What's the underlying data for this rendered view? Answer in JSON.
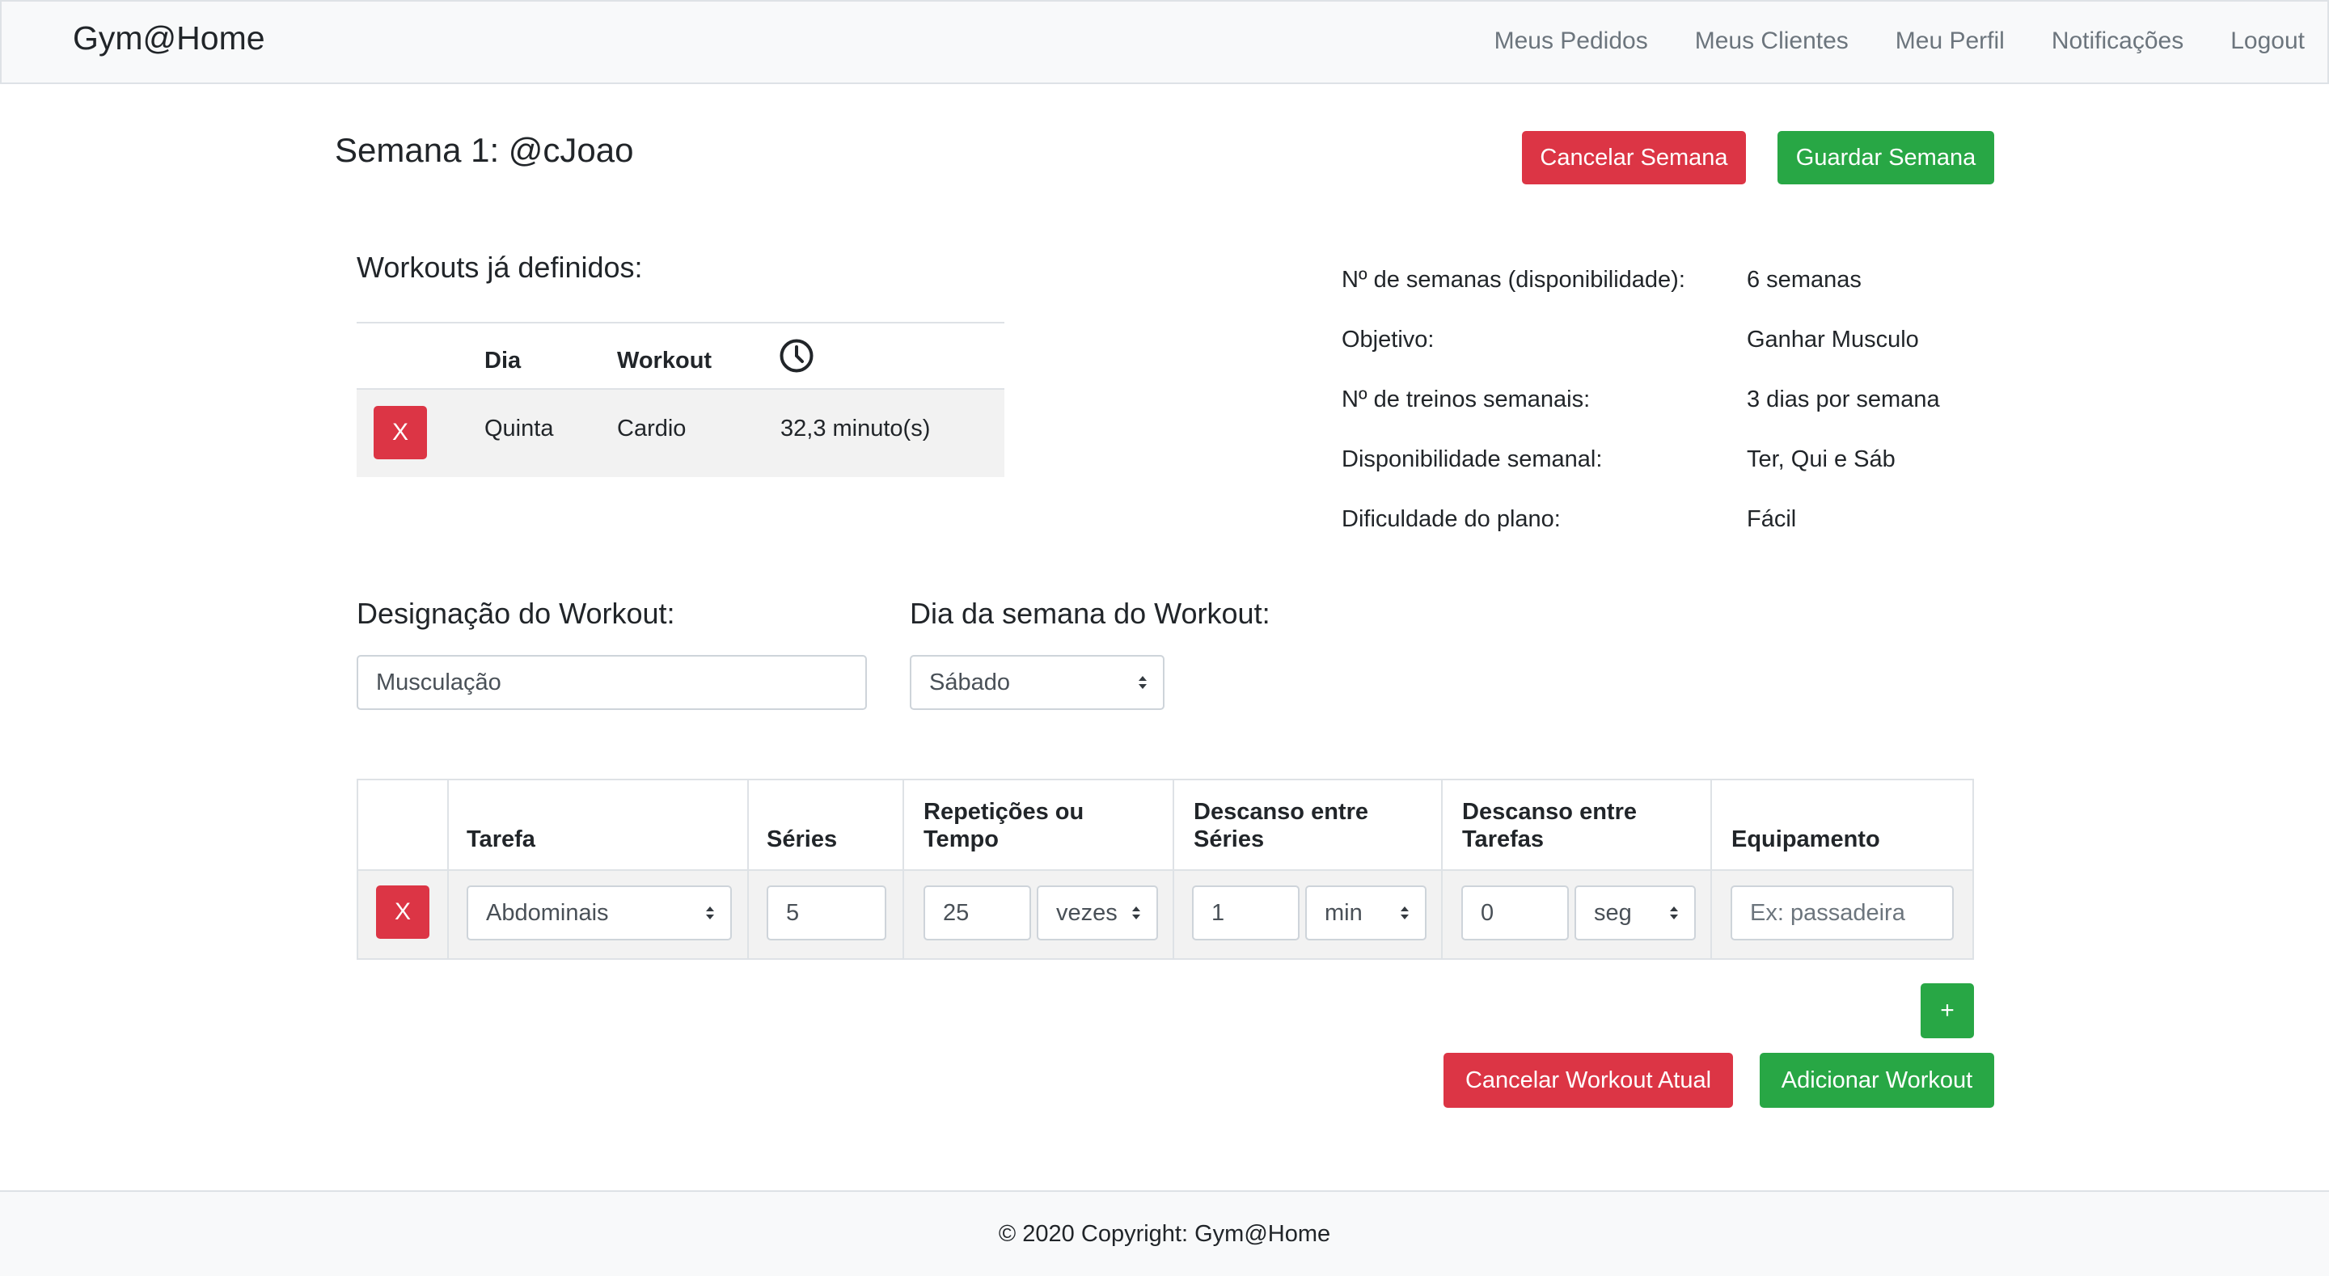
{
  "navbar": {
    "brand": "Gym@Home",
    "links": [
      "Meus Pedidos",
      "Meus Clientes",
      "Meu Perfil",
      "Notificações",
      "Logout"
    ]
  },
  "page": {
    "title": "Semana 1: @cJoao",
    "cancel_week": "Cancelar Semana",
    "save_week": "Guardar Semana"
  },
  "defined_workouts": {
    "title": "Workouts já definidos:",
    "headers": {
      "day": "Dia",
      "workout": "Workout",
      "duration_icon": "clock-icon"
    },
    "rows": [
      {
        "remove": "X",
        "day": "Quinta",
        "workout": "Cardio",
        "duration": "32,3 minuto(s)"
      }
    ]
  },
  "client_info": [
    {
      "label": "Nº de semanas (disponibilidade):",
      "value": "6 semanas"
    },
    {
      "label": "Objetivo:",
      "value": "Ganhar Musculo"
    },
    {
      "label": "Nº de treinos semanais:",
      "value": "3 dias por semana"
    },
    {
      "label": "Disponibilidade semanal:",
      "value": "Ter, Qui e Sáb"
    },
    {
      "label": "Dificuldade do plano:",
      "value": "Fácil"
    }
  ],
  "workout_form": {
    "name_label": "Designação do Workout:",
    "name_value": "Musculação",
    "day_label": "Dia da semana do Workout:",
    "day_value": "Sábado"
  },
  "tasks": {
    "headers": {
      "task": "Tarefa",
      "series": "Séries",
      "reps_line1": "Repetições ou",
      "reps_line2": "Tempo",
      "rest_series_line1": "Descanso entre",
      "rest_series_line2": "Séries",
      "rest_tasks_line1": "Descanso entre",
      "rest_tasks_line2": "Tarefas",
      "equipment": "Equipamento"
    },
    "rows": [
      {
        "remove": "X",
        "task": "Abdominais",
        "series": "5",
        "reps": "25",
        "reps_unit": "vezes",
        "rest_series": "1",
        "rest_series_unit": "min",
        "rest_tasks": "0",
        "rest_tasks_unit": "seg",
        "equipment_placeholder": "Ex: passadeira"
      }
    ],
    "add_label": "+"
  },
  "actions": {
    "cancel_workout": "Cancelar Workout Atual",
    "add_workout": "Adicionar Workout"
  },
  "footer": {
    "text": "© 2020 Copyright: Gym@Home"
  },
  "colors": {
    "danger": "#dc3545",
    "success": "#28a745",
    "navbar_bg": "#f8f9fa"
  }
}
